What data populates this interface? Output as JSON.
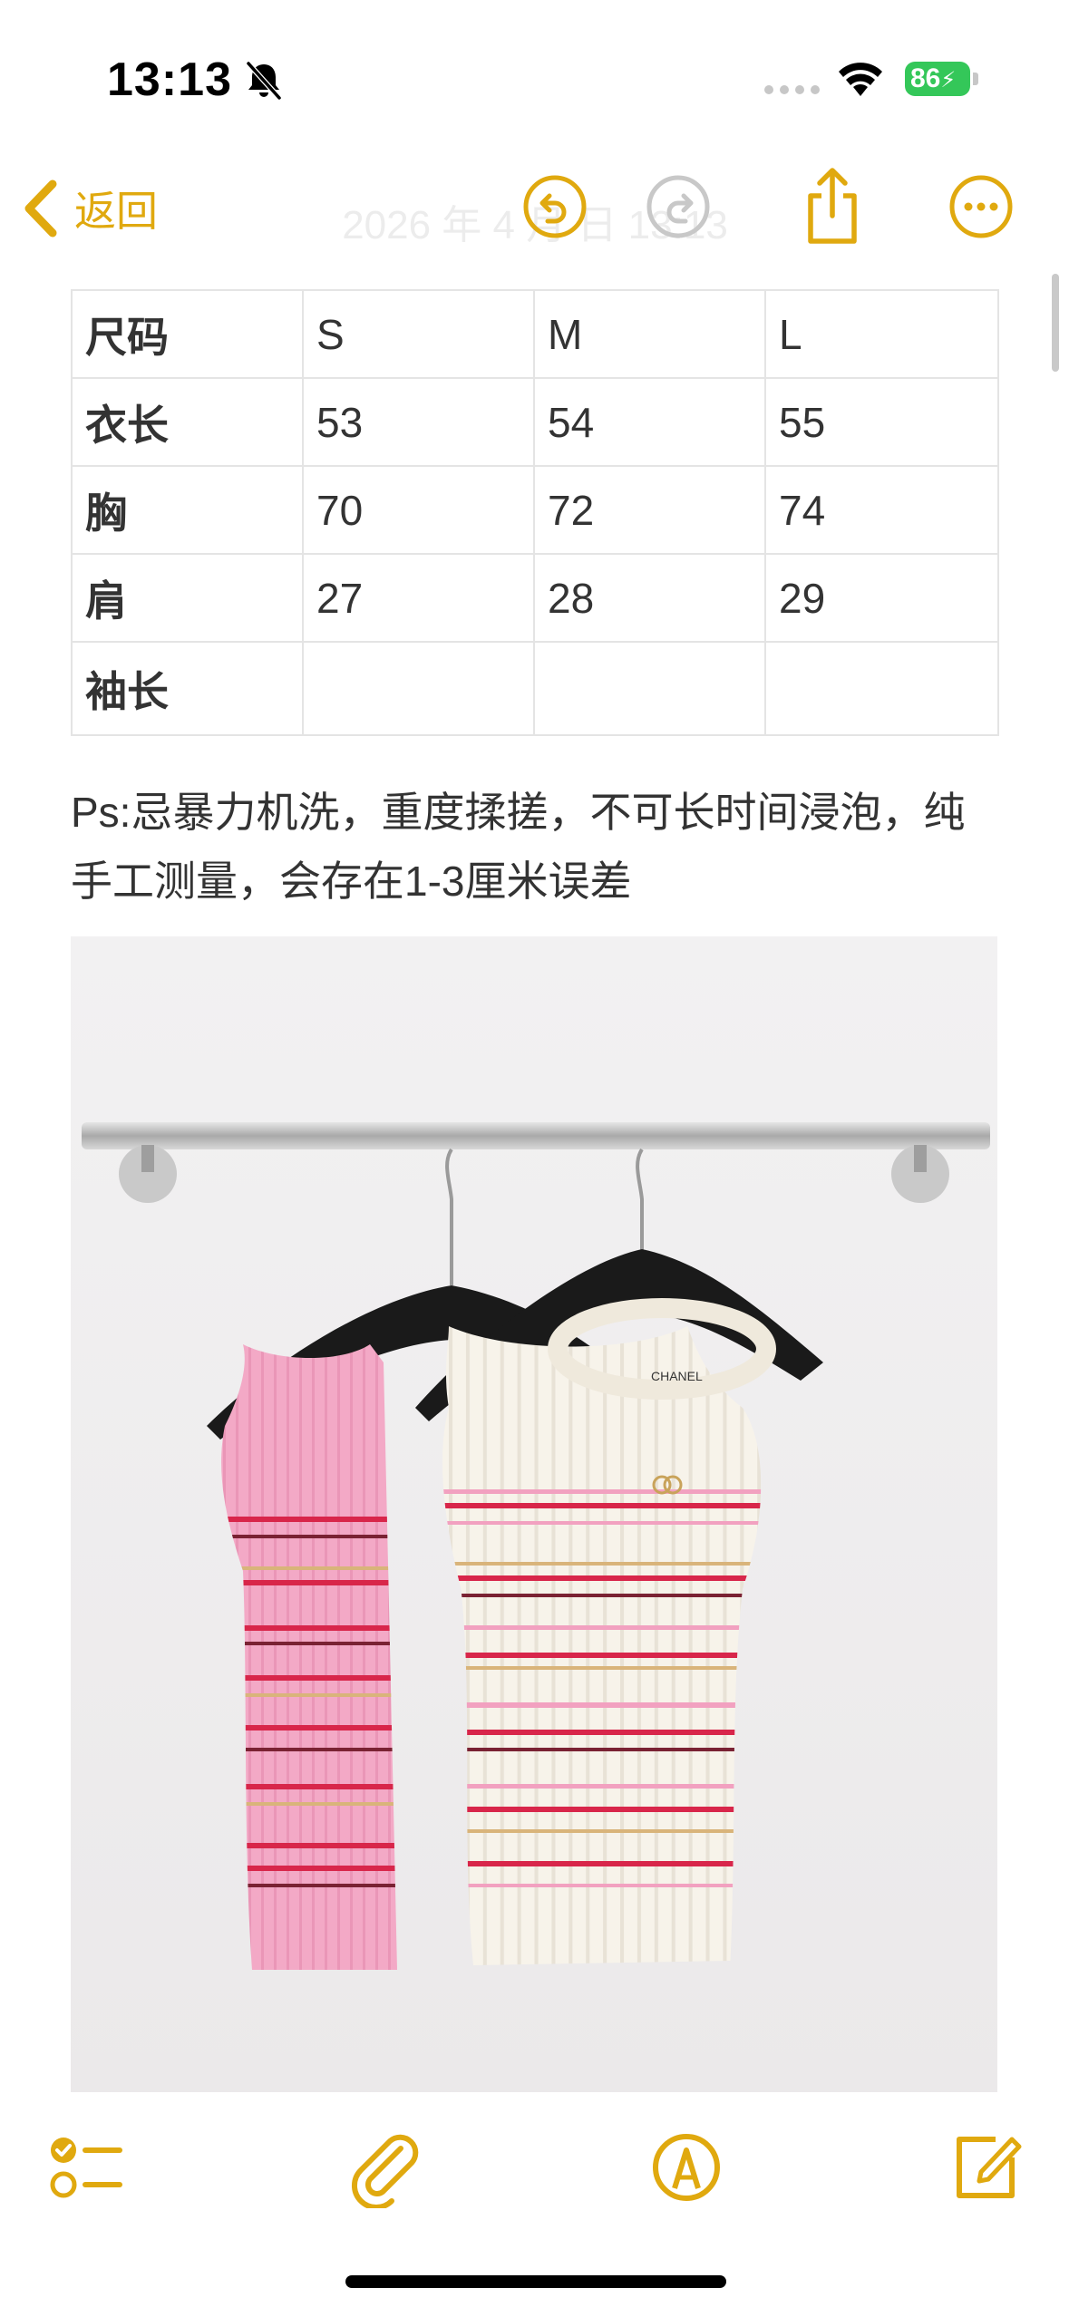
{
  "status_bar": {
    "time": "13:13",
    "battery_level": "86",
    "icons": [
      "bell-slash-icon",
      "cellular-signal-icon",
      "wifi-icon",
      "battery-charging-icon"
    ],
    "battery_color": "#34c759"
  },
  "nav": {
    "back_label": "返回",
    "title": "2026 年 4 月 日 13:13",
    "icons": [
      "chevron-left-icon",
      "undo-icon",
      "redo-icon",
      "share-icon",
      "more-icon"
    ],
    "accent_color": "#e0a90f"
  },
  "size_table": {
    "rows": [
      [
        "尺码",
        "S",
        "M",
        "L"
      ],
      [
        "衣长",
        "53",
        "54",
        "55"
      ],
      [
        "胸",
        "70",
        "72",
        "74"
      ],
      [
        "肩",
        "27",
        "28",
        "29"
      ],
      [
        "袖长",
        "",
        "",
        ""
      ]
    ]
  },
  "note": {
    "text": "Ps:忌暴力机洗，重度揉搓，不可长时间浸泡，纯手工测量，会存在1-3厘米误差"
  },
  "photo": {
    "label": "CHANEL",
    "shirt_colors": [
      "#f3a9c6",
      "#f7f3ea"
    ],
    "stripe_colors": [
      "#d8264a",
      "#7a2233",
      "#f2a1c0",
      "#d9b47a"
    ]
  },
  "toolbar": {
    "icons": [
      "checklist-icon",
      "paperclip-icon",
      "markup-pen-icon",
      "compose-icon"
    ]
  }
}
